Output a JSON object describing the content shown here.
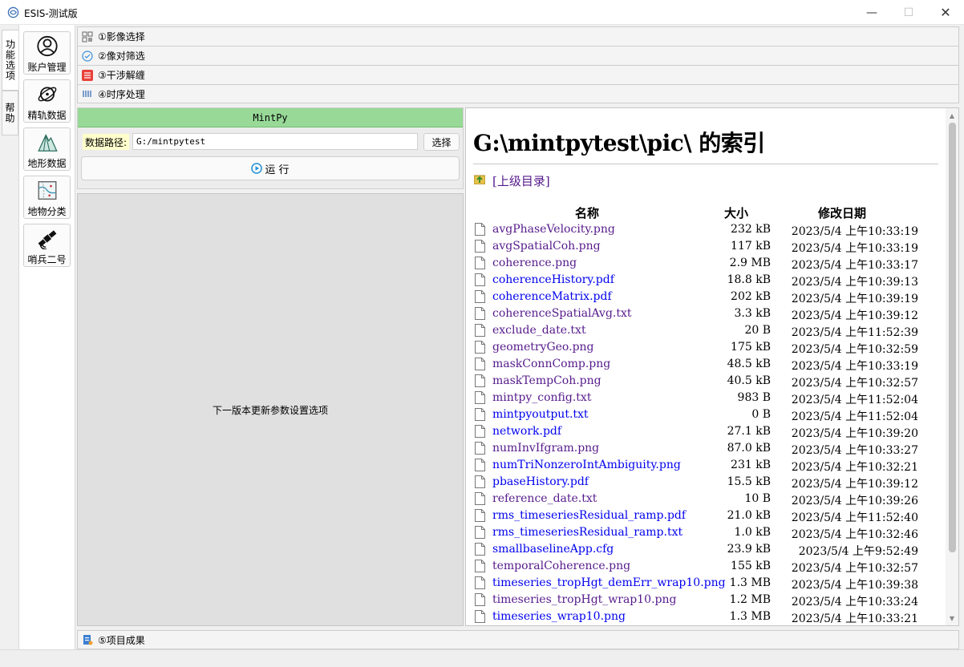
{
  "window": {
    "title": "ESIS-测试版",
    "minimize": "—",
    "maximize": "☐",
    "close": "✕"
  },
  "vtabs": [
    {
      "label": "功能选项",
      "active": true
    },
    {
      "label": "帮助",
      "active": false
    }
  ],
  "func_buttons": [
    {
      "label": "账户管理",
      "icon": "user-icon"
    },
    {
      "label": "精轨数据",
      "icon": "orbit-icon"
    },
    {
      "label": "地形数据",
      "icon": "terrain-icon"
    },
    {
      "label": "地物分类",
      "icon": "classification-icon"
    },
    {
      "label": "哨兵二号",
      "icon": "satellite-icon"
    }
  ],
  "accordion": [
    {
      "label": "①影像选择",
      "icon": "grid-icon"
    },
    {
      "label": "②像对筛选",
      "icon": "circle-check-icon"
    },
    {
      "label": "③干涉解缠",
      "icon": "interference-icon"
    },
    {
      "label": "④时序处理",
      "icon": "series-icon"
    }
  ],
  "mintpy": {
    "header": "MintPy",
    "path_label": "数据路径:",
    "path_value": "G:/mintpytest",
    "choose_label": "选择",
    "run_label": "运 行"
  },
  "placeholder_text": "下一版本更新参数设置选项",
  "browser": {
    "title": "G:\\mintpytest\\pic\\ 的索引",
    "parent_link": "[上级目录]",
    "col_name": "名称",
    "col_size": "大小",
    "col_date": "修改日期",
    "files": [
      {
        "name": "avgPhaseVelocity.png",
        "size": "232 kB",
        "date": "2023/5/4 上午10:33:19",
        "visited": true
      },
      {
        "name": "avgSpatialCoh.png",
        "size": "117 kB",
        "date": "2023/5/4 上午10:33:19",
        "visited": true
      },
      {
        "name": "coherence.png",
        "size": "2.9 MB",
        "date": "2023/5/4 上午10:33:17",
        "visited": true
      },
      {
        "name": "coherenceHistory.pdf",
        "size": "18.8 kB",
        "date": "2023/5/4 上午10:39:13",
        "visited": false
      },
      {
        "name": "coherenceMatrix.pdf",
        "size": "202 kB",
        "date": "2023/5/4 上午10:39:19",
        "visited": false
      },
      {
        "name": "coherenceSpatialAvg.txt",
        "size": "3.3 kB",
        "date": "2023/5/4 上午10:39:12",
        "visited": true
      },
      {
        "name": "exclude_date.txt",
        "size": "20 B",
        "date": "2023/5/4 上午11:52:39",
        "visited": true
      },
      {
        "name": "geometryGeo.png",
        "size": "175 kB",
        "date": "2023/5/4 上午10:32:59",
        "visited": true
      },
      {
        "name": "maskConnComp.png",
        "size": "48.5 kB",
        "date": "2023/5/4 上午10:33:19",
        "visited": true
      },
      {
        "name": "maskTempCoh.png",
        "size": "40.5 kB",
        "date": "2023/5/4 上午10:32:57",
        "visited": true
      },
      {
        "name": "mintpy_config.txt",
        "size": "983 B",
        "date": "2023/5/4 上午11:52:04",
        "visited": true
      },
      {
        "name": "mintpyoutput.txt",
        "size": "0 B",
        "date": "2023/5/4 上午11:52:04",
        "visited": false
      },
      {
        "name": "network.pdf",
        "size": "27.1 kB",
        "date": "2023/5/4 上午10:39:20",
        "visited": false
      },
      {
        "name": "numInvIfgram.png",
        "size": "87.0 kB",
        "date": "2023/5/4 上午10:33:27",
        "visited": true
      },
      {
        "name": "numTriNonzeroIntAmbiguity.png",
        "size": "231 kB",
        "date": "2023/5/4 上午10:32:21",
        "visited": false
      },
      {
        "name": "pbaseHistory.pdf",
        "size": "15.5 kB",
        "date": "2023/5/4 上午10:39:12",
        "visited": false
      },
      {
        "name": "reference_date.txt",
        "size": "10 B",
        "date": "2023/5/4 上午10:39:26",
        "visited": true
      },
      {
        "name": "rms_timeseriesResidual_ramp.pdf",
        "size": "21.0 kB",
        "date": "2023/5/4 上午11:52:40",
        "visited": false
      },
      {
        "name": "rms_timeseriesResidual_ramp.txt",
        "size": "1.0 kB",
        "date": "2023/5/4 上午10:32:46",
        "visited": false
      },
      {
        "name": "smallbaselineApp.cfg",
        "size": "23.9 kB",
        "date": "2023/5/4 上午9:52:49",
        "visited": false
      },
      {
        "name": "temporalCoherence.png",
        "size": "155 kB",
        "date": "2023/5/4 上午10:32:57",
        "visited": true
      },
      {
        "name": "timeseries_tropHgt_demErr_wrap10.png",
        "size": "1.3 MB",
        "date": "2023/5/4 上午10:39:38",
        "visited": false
      },
      {
        "name": "timeseries_tropHgt_wrap10.png",
        "size": "1.2 MB",
        "date": "2023/5/4 上午10:33:24",
        "visited": true
      },
      {
        "name": "timeseries_wrap10.png",
        "size": "1.3 MB",
        "date": "2023/5/4 上午10:33:21",
        "visited": false
      }
    ]
  },
  "results_bar": {
    "label": "⑤项目成果",
    "icon": "results-icon"
  },
  "colors": {
    "mintpy_header": "#98d998",
    "visited_link": "#551a8b",
    "unvisited_link": "#0000ee",
    "path_label_bg": "#ffffcc"
  }
}
